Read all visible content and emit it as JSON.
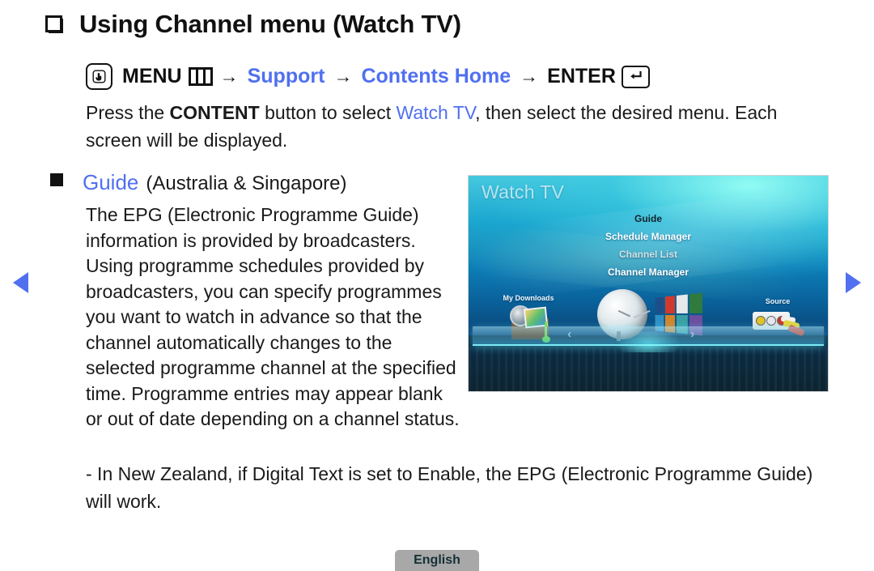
{
  "page": {
    "title": "Using Channel menu (Watch TV)",
    "title_bullet_icon": "square-outline-bullet-icon"
  },
  "menu_path": {
    "press_icon": "press-hand-icon",
    "menu_label": "MENU",
    "menu_grid_icon": "menu-grid-icon",
    "arrow": "→",
    "step1": "Support",
    "step2": "Contents Home",
    "enter_label": "ENTER",
    "enter_icon": "enter-return-icon"
  },
  "intro": {
    "part1": "Press the ",
    "bold": "CONTENT",
    "part2": " button to select ",
    "highlight": "Watch TV",
    "part3": ", then select the desired menu. Each screen will be displayed."
  },
  "guide_heading": {
    "bullet_icon": "square-bullet-icon",
    "name": "Guide",
    "region": "(Australia & Singapore)"
  },
  "body": {
    "paragraph": "The EPG (Electronic Programme Guide) information is provided by broadcasters. Using programme schedules provided by broadcasters, you can specify programmes you want to watch in advance so that the channel automatically changes to the selected programme channel at the specified time. Programme entries may appear blank or out of date depending on a channel status.",
    "note": "- In New Zealand, if Digital Text is set to Enable, the EPG (Electronic Programme Guide) will work."
  },
  "tv_screen": {
    "title": "Watch TV",
    "menu_items": [
      {
        "label": "Guide",
        "state": "selected"
      },
      {
        "label": "Schedule Manager",
        "state": "normal"
      },
      {
        "label": "Channel List",
        "state": "dim"
      },
      {
        "label": "Channel Manager",
        "state": "normal"
      }
    ],
    "shelf_items": [
      {
        "label": "My Downloads",
        "icon": "downloads-box-icon"
      },
      {
        "label": "Source",
        "icon": "av-connector-icon"
      }
    ],
    "shelf_nav": {
      "left": "‹",
      "right": "›"
    },
    "center_icon": "satellite-dish-icon"
  },
  "navigation": {
    "prev_icon": "prev-page-arrow-icon",
    "next_icon": "next-page-arrow-icon"
  },
  "footer": {
    "language": "English"
  },
  "colors": {
    "accent_blue": "#5070f0",
    "text": "#1a1a1a",
    "badge_bg": "#a8a8a8"
  }
}
